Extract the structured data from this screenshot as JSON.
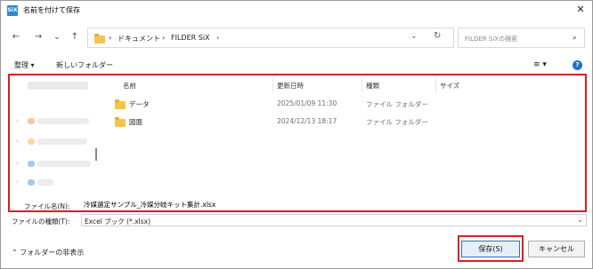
{
  "window": {
    "app_icon": "SiX",
    "title": "名前を付けて保存",
    "close_glyph": "✕"
  },
  "nav": {
    "back": "←",
    "forward": "→",
    "recent": "⌄",
    "up": "↑",
    "refresh": "↻",
    "address_dropdown": "⌄"
  },
  "address": {
    "sep1": "›",
    "crumb1": "ドキュメント",
    "sep2": "›",
    "crumb2": "FILDER SiX",
    "sep3": "›"
  },
  "search": {
    "placeholder": "FILDER SiXの検索",
    "icon_glyph": "⌕"
  },
  "toolbar": {
    "organize": "整理 ▾",
    "new_folder": "新しいフォルダー",
    "view_glyph": "≡ ▾",
    "help_glyph": "?"
  },
  "columns": [
    "名前",
    "更新日時",
    "種類",
    "サイズ"
  ],
  "files": [
    {
      "name": "データ",
      "modified": "2025/01/09 11:30",
      "type": "ファイル フォルダー"
    },
    {
      "name": "図面",
      "modified": "2024/12/13 18:17",
      "type": "ファイル フォルダー"
    }
  ],
  "tree_arrows": [
    "›",
    "›",
    "›",
    "›"
  ],
  "form": {
    "filename_label": "ファイル名(N):",
    "filename_value": "冷媒選定サンプル_冷媒分岐キット集計.xlsx",
    "filetype_label": "ファイルの種類(T):",
    "filetype_value": "Excel ブック (*.xlsx)",
    "dropdown_glyph": "⌄"
  },
  "footer": {
    "hide_folders": "⌃ フォルダーの非表示",
    "save": "保存(S)",
    "cancel": "キャンセル"
  }
}
